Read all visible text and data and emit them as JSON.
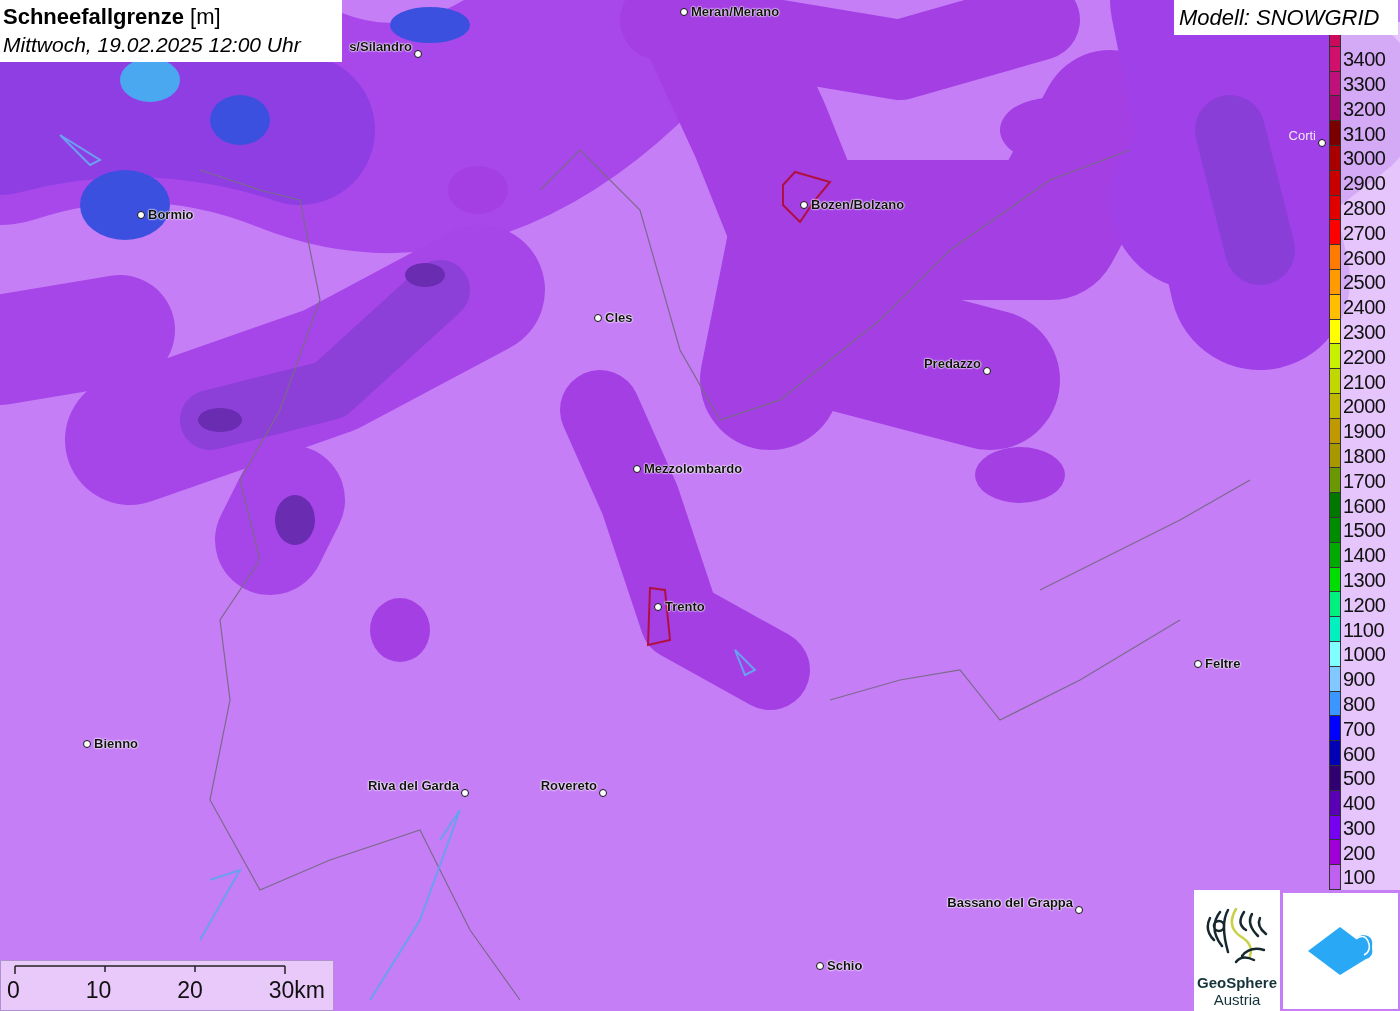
{
  "title": {
    "heading": "**Schneefallgrenze** [m]",
    "date": "Mittwoch, 19.02.2025 12:00 Uhr"
  },
  "model": "Modell: SNOWGRID",
  "cities": [
    {
      "name": "s/Silandro"
    },
    {
      "name": "Meran/Merano"
    },
    {
      "name": "Corti"
    },
    {
      "name": "Bormio"
    },
    {
      "name": "Bozen/Bolzano"
    },
    {
      "name": "Cles"
    },
    {
      "name": "Predazzo"
    },
    {
      "name": "Mezzolombardo"
    },
    {
      "name": "Trento"
    },
    {
      "name": "Feltre"
    },
    {
      "name": "Bienno"
    },
    {
      "name": "Riva del Garda"
    },
    {
      "name": "Rovereto"
    },
    {
      "name": "Bassano del Grappa"
    },
    {
      "name": "Schio"
    }
  ],
  "legend": [
    {
      "color": "#cc0a5c"
    },
    {
      "label": "3400",
      "color": "#d0106a"
    },
    {
      "label": "3300",
      "color": "#c0107a"
    },
    {
      "label": "3200",
      "color": "#a00870"
    },
    {
      "label": "3100",
      "color": "#7a0000"
    },
    {
      "label": "3000",
      "color": "#a80000"
    },
    {
      "label": "2900",
      "color": "#c80000"
    },
    {
      "label": "2800",
      "color": "#e00000"
    },
    {
      "label": "2700",
      "color": "#ff0000"
    },
    {
      "label": "2600",
      "color": "#ff7a00"
    },
    {
      "label": "2500",
      "color": "#ff9a00"
    },
    {
      "label": "2400",
      "color": "#ffbe00"
    },
    {
      "label": "2300",
      "color": "#ffff00"
    },
    {
      "label": "2200",
      "color": "#c8f000"
    },
    {
      "label": "2100",
      "color": "#c0d800"
    },
    {
      "label": "2000",
      "color": "#c0b800"
    },
    {
      "label": "1900",
      "color": "#c09800"
    },
    {
      "label": "1800",
      "color": "#a89800"
    },
    {
      "label": "1700",
      "color": "#6a9800"
    },
    {
      "label": "1600",
      "color": "#007800"
    },
    {
      "label": "1500",
      "color": "#008c00"
    },
    {
      "label": "1400",
      "color": "#00aa00"
    },
    {
      "label": "1300",
      "color": "#00dd00"
    },
    {
      "label": "1200",
      "color": "#00f080"
    },
    {
      "label": "1100",
      "color": "#00f0c0"
    },
    {
      "label": "1000",
      "color": "#80ffff"
    },
    {
      "label": "900",
      "color": "#80c8ff"
    },
    {
      "label": "800",
      "color": "#3c96ff"
    },
    {
      "label": "700",
      "color": "#0000ff"
    },
    {
      "label": "600",
      "color": "#0000b4"
    },
    {
      "label": "500",
      "color": "#300070"
    },
    {
      "label": "400",
      "color": "#5a00b4"
    },
    {
      "label": "300",
      "color": "#7800f0"
    },
    {
      "label": "200",
      "color": "#a000d8"
    },
    {
      "label": "100",
      "color": "#c060f0"
    }
  ],
  "scale": [
    "0",
    "10",
    "20",
    "30km"
  ],
  "logo": {
    "name": "GeoSphere",
    "sub": "Austria"
  }
}
